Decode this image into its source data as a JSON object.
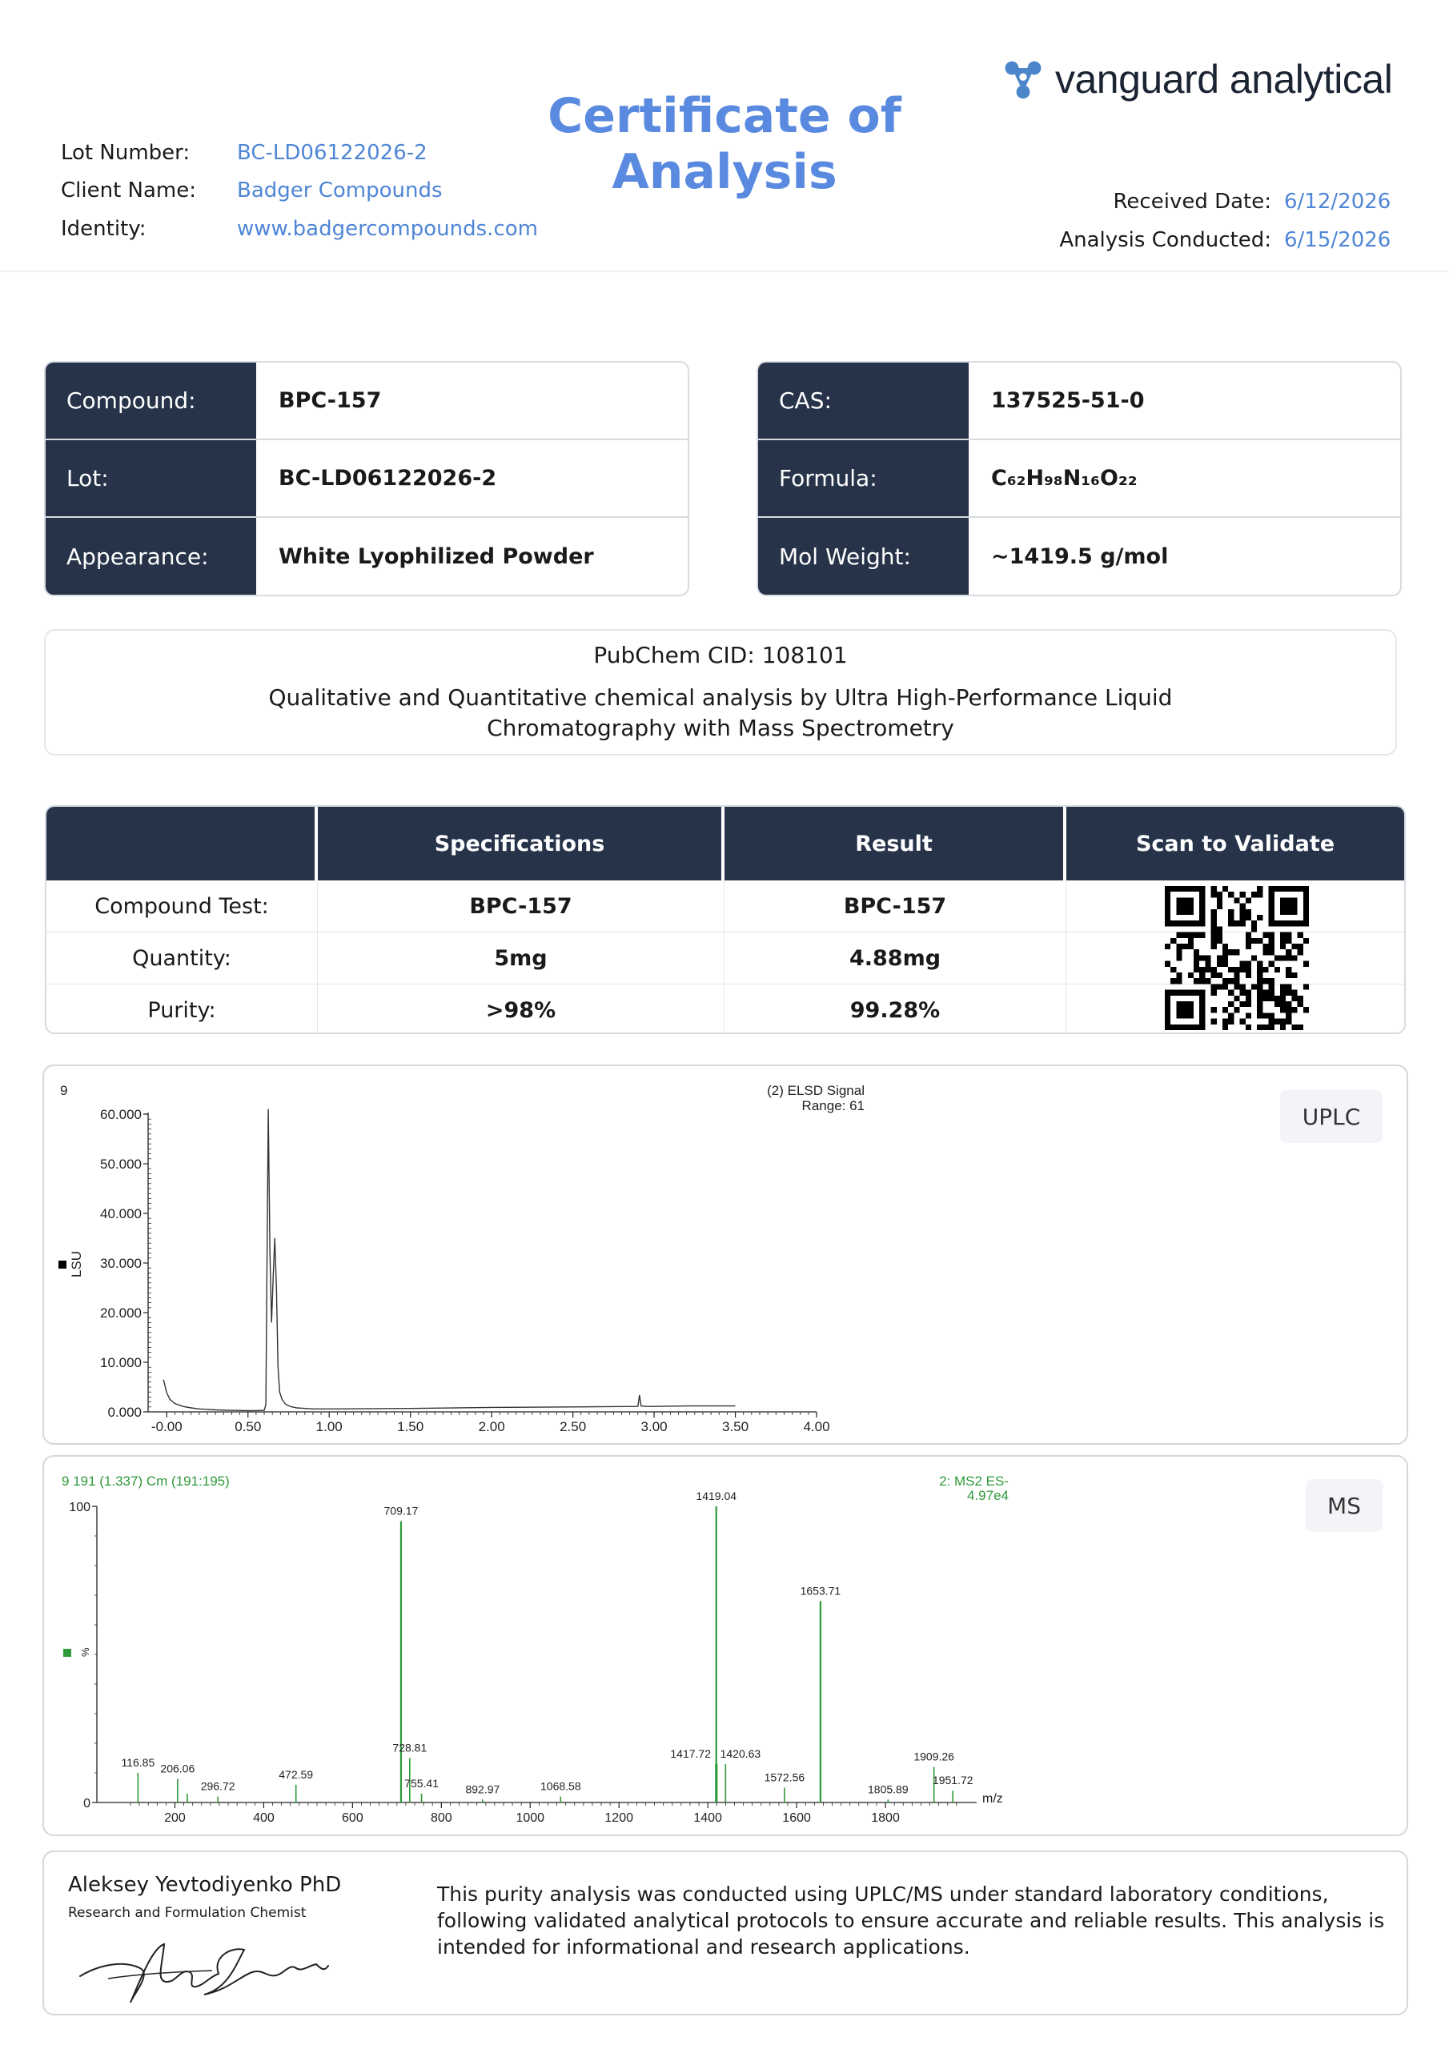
{
  "header": {
    "brand": "vanguard analytical",
    "title": "Certificate of Analysis",
    "lot_label": "Lot Number:",
    "lot_value": "BC-LD06122026-2",
    "client_label": "Client Name:",
    "client_value": "Badger Compounds",
    "identity_label": "Identity:",
    "identity_value": "www.badgercompounds.com",
    "received_label": "Received Date:",
    "received_value": "6/12/2026",
    "analysis_label": "Analysis Conducted:",
    "analysis_value": "6/15/2026"
  },
  "left_info": [
    {
      "label": "Compound:",
      "value": "BPC-157"
    },
    {
      "label": "Lot:",
      "value": "BC-LD06122026-2"
    },
    {
      "label": "Appearance:",
      "value": "White Lyophilized Powder"
    }
  ],
  "right_info": [
    {
      "label": "CAS:",
      "value": "137525-51-0"
    },
    {
      "label": "Formula:",
      "value": "C₆₂H₉₈N₁₆O₂₂"
    },
    {
      "label": "Mol Weight:",
      "value": "~1419.5 g/mol"
    }
  ],
  "pubchem": {
    "cid": "PubChem CID: 108101",
    "method_line1": "Qualitative and Quantitative chemical analysis by Ultra High-Performance Liquid",
    "method_line2": "Chromatography with Mass Spectrometry"
  },
  "results": {
    "headers": [
      "",
      "Specifications",
      "Result",
      "Scan to Validate"
    ],
    "rows": [
      {
        "test": "Compound Test:",
        "spec": "BPC-157",
        "result": "BPC-157"
      },
      {
        "test": "Quantity:",
        "spec": "5mg",
        "result": "4.88mg"
      },
      {
        "test": "Purity:",
        "spec": ">98%",
        "result": "99.28%"
      }
    ]
  },
  "chart_data": [
    {
      "type": "line",
      "tag": "UPLC",
      "trace_id": "9",
      "legend_line1": "(2) ELSD Signal",
      "legend_line2": "Range: 61",
      "ylabel": "LSU",
      "xlim": [
        -0.1,
        4.0
      ],
      "ylim": [
        0,
        60
      ],
      "x_ticks": [
        "-0.00",
        "0.50",
        "1.00",
        "1.50",
        "2.00",
        "2.50",
        "3.00",
        "3.50",
        "4.00"
      ],
      "y_ticks": [
        "0.000",
        "10.000",
        "20.000",
        "30.000",
        "40.000",
        "50.000",
        "60.000"
      ],
      "series": [
        {
          "x": [
            -0.02,
            0.0,
            0.02,
            0.05,
            0.1,
            0.15,
            0.2,
            0.3,
            0.4,
            0.5,
            0.55,
            0.6,
            0.61,
            0.625,
            0.635,
            0.645,
            0.655,
            0.665,
            0.675,
            0.685,
            0.695,
            0.71,
            0.73,
            0.76,
            0.8,
            0.9,
            1.0,
            1.5,
            2.0,
            2.5,
            2.9,
            2.91,
            2.92,
            2.95,
            3.0,
            3.2,
            3.5
          ],
          "y": [
            6.5,
            3.8,
            2.5,
            1.7,
            1.1,
            0.8,
            0.6,
            0.4,
            0.3,
            0.25,
            0.25,
            0.3,
            1.5,
            61.0,
            32.0,
            18.0,
            27.0,
            35.0,
            25.0,
            9.0,
            4.0,
            2.5,
            1.6,
            1.1,
            0.8,
            0.6,
            0.6,
            0.7,
            0.9,
            1.0,
            1.1,
            3.4,
            1.2,
            1.1,
            1.1,
            1.2,
            1.2
          ]
        }
      ]
    },
    {
      "type": "bar",
      "tag": "MS",
      "trace_id": "9 191 (1.337) Cm (191:195)",
      "legend_line1": "2: MS2 ES-",
      "legend_line2": "4.97e4",
      "ylabel": "%",
      "xlabel": "m/z",
      "xlim": [
        100,
        2000
      ],
      "ylim": [
        0,
        100
      ],
      "x_ticks": [
        200,
        400,
        600,
        800,
        1000,
        1200,
        1400,
        1600,
        1800
      ],
      "y_ticks": [
        "0",
        "100"
      ],
      "peaks": [
        {
          "x": 116.85,
          "y": 10,
          "label": "116.85"
        },
        {
          "x": 206.06,
          "y": 8,
          "label": "206.06"
        },
        {
          "x": 228.0,
          "y": 3,
          "label": ""
        },
        {
          "x": 296.72,
          "y": 2,
          "label": "296.72"
        },
        {
          "x": 472.59,
          "y": 6,
          "label": "472.59"
        },
        {
          "x": 709.17,
          "y": 95,
          "label": "709.17"
        },
        {
          "x": 728.81,
          "y": 15,
          "label": "728.81"
        },
        {
          "x": 755.41,
          "y": 3,
          "label": "755.41"
        },
        {
          "x": 892.97,
          "y": 1,
          "label": "892.97"
        },
        {
          "x": 1068.58,
          "y": 2,
          "label": "1068.58"
        },
        {
          "x": 1417.72,
          "y": 13,
          "label": "1417.72"
        },
        {
          "x": 1419.04,
          "y": 100,
          "label": "1419.04"
        },
        {
          "x": 1420.63,
          "y": 13,
          "label": "1420.63"
        },
        {
          "x": 1440.0,
          "y": 13,
          "label": ""
        },
        {
          "x": 1572.56,
          "y": 5,
          "label": "1572.56"
        },
        {
          "x": 1653.71,
          "y": 68,
          "label": "1653.71"
        },
        {
          "x": 1805.89,
          "y": 1,
          "label": "1805.89"
        },
        {
          "x": 1909.26,
          "y": 12,
          "label": "1909.26"
        },
        {
          "x": 1951.72,
          "y": 4,
          "label": "1951.72"
        }
      ]
    }
  ],
  "signature": {
    "name": "Aleksey Yevtodiyenko PhD",
    "role": "Research and Formulation Chemist",
    "statement": "This purity analysis was conducted using UPLC/MS under standard laboratory conditions, following validated analytical protocols to ensure accurate and reliable results. This analysis is intended for informational and research applications."
  },
  "colors": {
    "navy": "#263349",
    "accent_blue": "#5a8ae0",
    "link_blue": "#4f86d6",
    "ms_green": "#2e9a3a"
  }
}
